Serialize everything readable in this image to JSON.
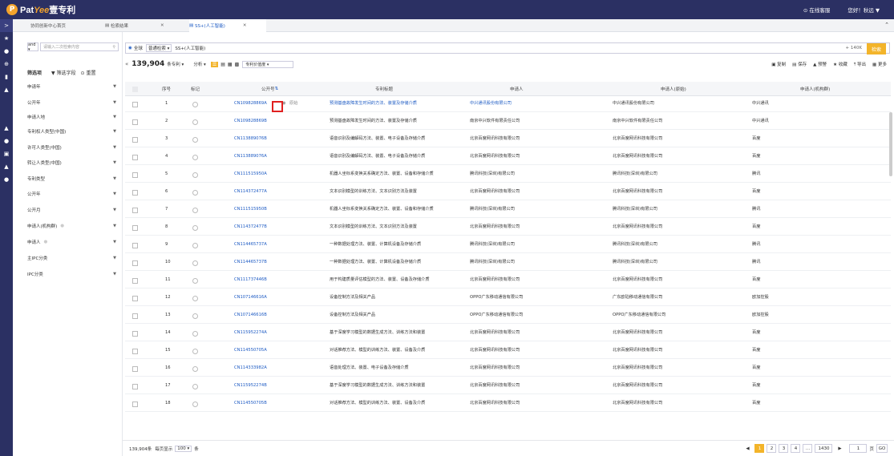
{
  "topbar": {
    "logo_mark": "P",
    "logo_pat": "Pat",
    "logo_yee": "Yee",
    "logo_cn": "壹专利",
    "service": "在线客服",
    "greeting": "您好！秋远 ▼"
  },
  "iconbar": [
    ">",
    "★",
    "●",
    "⊕",
    "▮",
    "▲",
    "▲",
    "●",
    "▣",
    "▲",
    "●"
  ],
  "tabs": [
    {
      "label": "协同创新中心首页"
    },
    {
      "label": "检索结果"
    },
    {
      "label": "SS+(人工智能)"
    }
  ],
  "search": {
    "logic": "and ▾",
    "placeholder": "请输入二次检索内容",
    "scope": "全球",
    "mode": "普通检索 ▾",
    "query": "SS+(人工智能)",
    "extra": "+ 140K",
    "button": "检索"
  },
  "sidebar": {
    "title": "筛选项",
    "filter_field": "▼ 筛选字段",
    "collapse": "⊙ 重置",
    "items": [
      "申请年",
      "公开年",
      "申请人地",
      "专利权人类型(中国)",
      "许可人类型(中国)",
      "转让人类型(中国)",
      "专利类型",
      "公开年",
      "公开月",
      "申请人(机构群)",
      "申请人",
      "主IPC分类",
      "IPC分类"
    ]
  },
  "toolbar": {
    "count": "139,904",
    "count_unit": "条专利 ▾",
    "analyze": "分析 ▾",
    "value": "专利价值度",
    "actions": [
      "复制",
      "保存",
      "预警",
      "收藏",
      "导出",
      "更多"
    ]
  },
  "table": {
    "headers": [
      "序号",
      "标记",
      "公开号",
      "专利标题",
      "申请人",
      "申请人(原始)",
      "申请人(机构群)"
    ],
    "rows": [
      [
        "1",
        "CN109828869A",
        "预测基盘故障发生时间的方法、装置及存储介质",
        "中兴通讯股份有限公司",
        "中兴通讯股份有限公司",
        "中兴通讯"
      ],
      [
        "2",
        "CN109828869B",
        "预测基盘故障发生时间的方法、装置及存储介质",
        "南京中兴软件有限责任公司",
        "南京中兴软件有限责任公司",
        "中兴通讯"
      ],
      [
        "3",
        "CN113889076B",
        "语音识别及编解码方法、装置、电子设备及存储介质",
        "北京百度网讯科技有限公司",
        "北京百度网讯科技有限公司",
        "百度"
      ],
      [
        "4",
        "CN113889076A",
        "语音识别及编解码方法、装置、电子设备及存储介质",
        "北京百度网讯科技有限公司",
        "北京百度网讯科技有限公司",
        "百度"
      ],
      [
        "5",
        "CN111515950A",
        "机器人坐标系变换关系确定方法、装置、设备和存储介质",
        "腾讯科技(深圳)有限公司",
        "腾讯科技(深圳)有限公司",
        "腾讯"
      ],
      [
        "6",
        "CN114372477A",
        "文本识别模型的训练方法、文本识别方法及装置",
        "北京百度网讯科技有限公司",
        "北京百度网讯科技有限公司",
        "百度"
      ],
      [
        "7",
        "CN111515950B",
        "机器人坐标系变换关系确定方法、装置、设备和存储介质",
        "腾讯科技(深圳)有限公司",
        "腾讯科技(深圳)有限公司",
        "腾讯"
      ],
      [
        "8",
        "CN114372477B",
        "文本识别模型的训练方法、文本识别方法及装置",
        "北京百度网讯科技有限公司",
        "北京百度网讯科技有限公司",
        "百度"
      ],
      [
        "9",
        "CN114465737A",
        "一种数据处理方法、装置、计算机设备及存储介质",
        "腾讯科技(深圳)有限公司",
        "腾讯科技(深圳)有限公司",
        "腾讯"
      ],
      [
        "10",
        "CN114465737B",
        "一种数据处理方法、装置、计算机设备及存储介质",
        "腾讯科技(深圳)有限公司",
        "腾讯科技(深圳)有限公司",
        "腾讯"
      ],
      [
        "11",
        "CN111737446B",
        "用于构建质量评估模型的方法、装置、设备及存储介质",
        "北京百度网讯科技有限公司",
        "北京百度网讯科技有限公司",
        "百度"
      ],
      [
        "12",
        "CN107146616A",
        "设备控制方法及相关产品",
        "OPPO广东移动通信有限公司",
        "广东欧珀移动通信有限公司",
        "欧加控股"
      ],
      [
        "13",
        "CN107146616B",
        "设备控制方法及相关产品",
        "OPPO广东移动通信有限公司",
        "OPPO广东移动通信有限公司",
        "欧加控股"
      ],
      [
        "14",
        "CN115952274A",
        "基于深度学习模型的数据生成方法、训练方法和装置",
        "北京百度网讯科技有限公司",
        "北京百度网讯科技有限公司",
        "百度"
      ],
      [
        "15",
        "CN114550705A",
        "对话推荐方法、模型的训练方法、装置、设备及介质",
        "北京百度网讯科技有限公司",
        "北京百度网讯科技有限公司",
        "百度"
      ],
      [
        "16",
        "CN114333982A",
        "语音处理方法、装置、电子设备及存储介质",
        "北京百度网讯科技有限公司",
        "北京百度网讯科技有限公司",
        "百度"
      ],
      [
        "17",
        "CN115952274B",
        "基于深度学习模型的数据生成方法、训练方法和装置",
        "北京百度网讯科技有限公司",
        "北京百度网讯科技有限公司",
        "百度"
      ],
      [
        "18",
        "CN114550705B",
        "对话推荐方法、模型的训练方法、装置、设备及介质",
        "北京百度网讯科技有限公司",
        "北京百度网讯科技有限公司",
        "百度"
      ]
    ],
    "row1_tag": "原始"
  },
  "footer": {
    "total": "139,904条",
    "per_page_label": "每页显示",
    "per_page": "100 ▾",
    "unit": "条",
    "pages": [
      "1",
      "2",
      "3",
      "4",
      "...",
      "1430"
    ],
    "goto": "1",
    "page_unit": "页",
    "go": "GO"
  },
  "colors": {
    "nav": "#2b3063",
    "accent": "#f3b42a",
    "link": "#1f5cc4",
    "highlight": "#e02020"
  }
}
